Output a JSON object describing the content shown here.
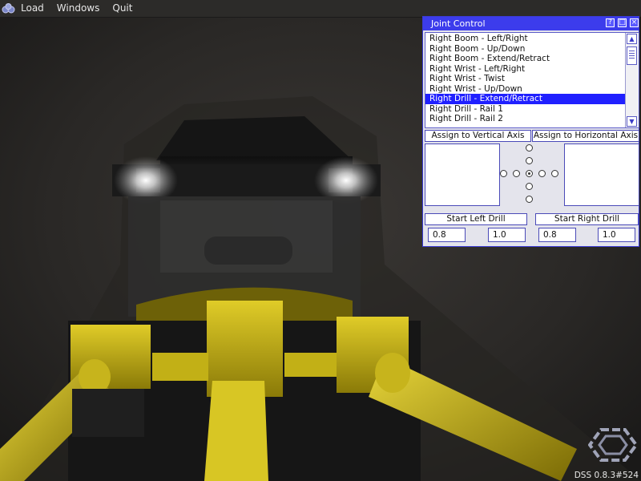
{
  "menubar": {
    "logo_icon": "app-logo-icon",
    "items": [
      "Load",
      "Windows",
      "Quit"
    ]
  },
  "panel": {
    "title": "Joint Control",
    "window_buttons": [
      "?",
      "□",
      "×"
    ],
    "joints": [
      "Right Boom - Left/Right",
      "Right Boom - Up/Down",
      "Right Boom - Extend/Retract",
      "Right Wrist - Left/Right",
      "Right Wrist - Twist",
      "Right Wrist - Up/Down",
      "Right Drill - Extend/Retract",
      "Right Drill - Rail 1",
      "Right Drill - Rail 2"
    ],
    "selected_index": 6,
    "assign_vertical_label": "Assign to Vertical Axis",
    "assign_horizontal_label": "Assign to Horizontal Axis",
    "start_left_label": "Start Left Drill",
    "start_right_label": "Start Right Drill",
    "left_drill_values": [
      "0.8",
      "1.0"
    ],
    "right_drill_values": [
      "0.8",
      "1.0"
    ]
  },
  "status": {
    "version": "DSS 0.8.3#524",
    "logo_icon": "hexagon-logo-icon"
  },
  "colors": {
    "selection": "#2020ff",
    "titlebar": "#3c3cec",
    "drill_yellow": "#d6c21a"
  }
}
